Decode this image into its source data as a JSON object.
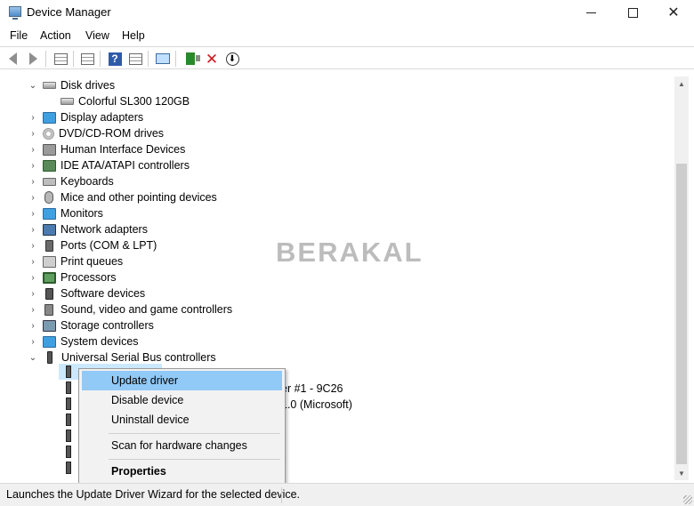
{
  "window": {
    "title": "Device Manager"
  },
  "menu": [
    "File",
    "Action",
    "View",
    "Help"
  ],
  "tree": {
    "disk_drives": {
      "label": "Disk drives",
      "children": [
        "Colorful SL300 120GB"
      ]
    },
    "categories": [
      "Display adapters",
      "DVD/CD-ROM drives",
      "Human Interface Devices",
      "IDE ATA/ATAPI controllers",
      "Keyboards",
      "Mice and other pointing devices",
      "Monitors",
      "Network adapters",
      "Ports (COM & LPT)",
      "Print queues",
      "Processors",
      "Software devices",
      "Sound, video and game controllers",
      "Storage controllers",
      "System devices"
    ],
    "usb": {
      "label": "Universal Serial Bus controllers",
      "visible_child_text": [
        "er #1 - 9C26",
        "1.0 (Microsoft)"
      ]
    }
  },
  "watermark": "BERAKAL",
  "context_menu": {
    "update": "Update driver",
    "disable": "Disable device",
    "uninstall": "Uninstall device",
    "scan": "Scan for hardware changes",
    "properties": "Properties"
  },
  "status": {
    "text": "Launches the Update Driver Wizard for the selected device."
  },
  "icons": [
    "back-icon",
    "forward-icon",
    "properties-icon",
    "help-icon",
    "monitor-icon",
    "update-driver-icon",
    "uninstall-icon",
    "download-icon"
  ]
}
